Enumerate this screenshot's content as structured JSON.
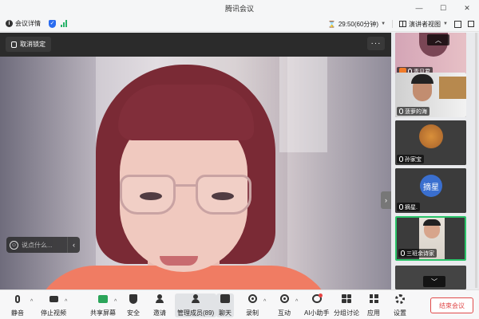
{
  "window": {
    "title": "腾讯会议"
  },
  "infobar": {
    "meeting_info_label": "会议详情",
    "timer_text": "29:50(60分钟)",
    "view_label": "演讲者视图"
  },
  "stage": {
    "unlock_label": "取消锁定",
    "more_label": "···",
    "chat_placeholder": "说点什么..."
  },
  "participants": [
    {
      "name": "青见君",
      "kind": "photo"
    },
    {
      "name": "菠萝的海",
      "kind": "photo"
    },
    {
      "name": "孙家宝",
      "kind": "photo"
    },
    {
      "name": "摘星.",
      "kind": "avatar",
      "avatar_text": "摘星"
    },
    {
      "name": "三班余诗家",
      "kind": "photo",
      "active": true
    },
    {
      "name": "",
      "kind": "photo"
    }
  ],
  "toolbar": {
    "mute": "静音",
    "stop_video": "停止视频",
    "share_screen": "共享屏幕",
    "security": "安全",
    "invite": "邀请",
    "manage_members": "管理成员(89)",
    "chat": "聊天",
    "record": "录制",
    "interact": "互动",
    "ai_assistant": "AI小助手",
    "breakout": "分组讨论",
    "apps": "应用",
    "settings": "设置",
    "end_meeting": "结束会议"
  },
  "colors": {
    "accent_green": "#2bc46a",
    "end_red": "#e04a4a",
    "signal_green": "#27b36a",
    "brand_blue": "#2a6cf0"
  }
}
